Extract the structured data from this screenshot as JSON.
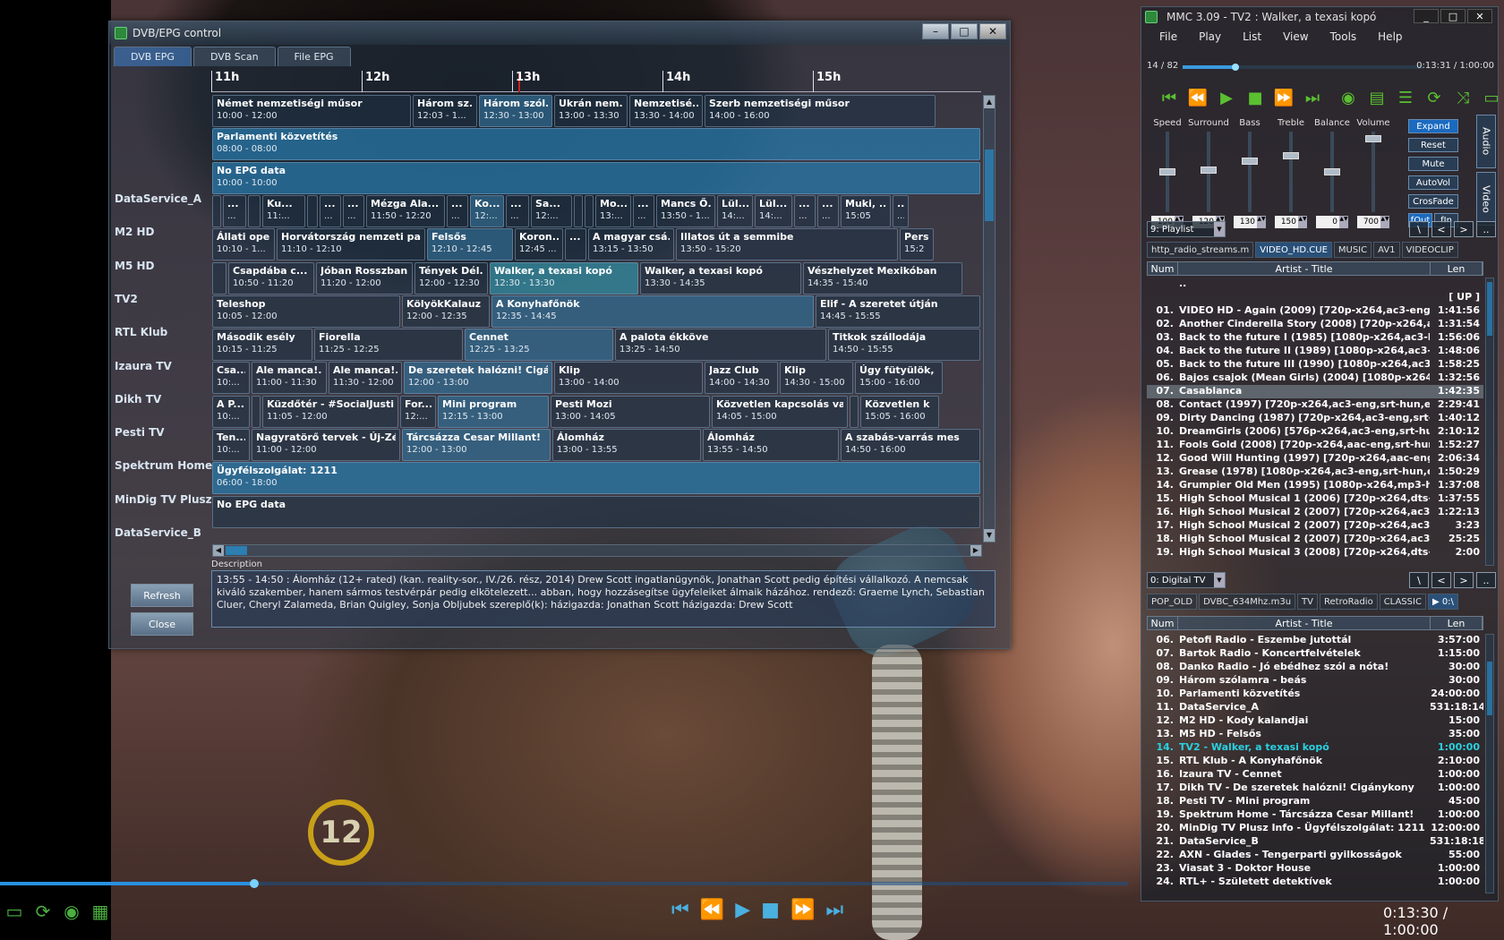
{
  "dvb": {
    "title": "DVB/EPG control",
    "tabs": [
      {
        "label": "DVB EPG",
        "active": true
      },
      {
        "label": "DVB Scan",
        "active": false
      },
      {
        "label": "File EPG",
        "active": false
      }
    ],
    "hours": [
      "11h",
      "12h",
      "13h",
      "14h",
      "15h"
    ],
    "channels": [
      "DataService_A",
      "M2 HD",
      "M5 HD",
      "TV2",
      "RTL Klub",
      "Izaura TV",
      "Dikh TV",
      "Pesti TV",
      "Spektrum Home",
      "MinDig TV Plusz",
      "DataService_B"
    ],
    "rows": [
      [
        {
          "t": "Német nemzetiségi műsor",
          "tm": "10:00 - 12:00"
        },
        {
          "t": "Három sz...",
          "tm": "12:03 - 1..."
        },
        {
          "t": "Három szól...",
          "tm": "12:30 - 13:00"
        },
        {
          "t": "Ukrán nem...",
          "tm": "13:00 - 13:30"
        },
        {
          "t": "Nemzetisé...",
          "tm": "13:30 - 14:00"
        },
        {
          "t": "Szerb nemzetiségi műsor",
          "tm": "14:00 - 16:00"
        }
      ],
      [
        {
          "t": "Parlamenti közvetítés",
          "tm": "08:00 - 08:00"
        }
      ],
      [
        {
          "t": "No EPG data",
          "tm": "10:00 - 10:00"
        }
      ],
      [
        {
          "t": "",
          "tm": ""
        },
        {
          "t": "...",
          "tm": "..."
        },
        {
          "t": "",
          "tm": ""
        },
        {
          "t": "Ku...",
          "tm": "11:..."
        },
        {
          "t": "",
          "tm": ""
        },
        {
          "t": "...",
          "tm": "..."
        },
        {
          "t": "...",
          "tm": "..."
        },
        {
          "t": "Mézga Ala...",
          "tm": "11:50 - 12:20"
        },
        {
          "t": "...",
          "tm": "..."
        },
        {
          "t": "Ko...",
          "tm": "12:..."
        },
        {
          "t": "...",
          "tm": "..."
        },
        {
          "t": "Sa...",
          "tm": "12:..."
        },
        {
          "t": "",
          "tm": ""
        },
        {
          "t": "",
          "tm": ""
        },
        {
          "t": "Mo...",
          "tm": "13:..."
        },
        {
          "t": "...",
          "tm": "..."
        },
        {
          "t": "Mancs Ő...",
          "tm": "13:50 - 1..."
        },
        {
          "t": "Lül...",
          "tm": "14:..."
        },
        {
          "t": "Lül...",
          "tm": "14:..."
        },
        {
          "t": "...",
          "tm": "..."
        },
        {
          "t": "...",
          "tm": "..."
        },
        {
          "t": "Muki, ...",
          "tm": "15:05"
        },
        {
          "t": "...",
          "tm": "..."
        }
      ],
      [
        {
          "t": "Állati ope...",
          "tm": "10:10 - 1..."
        },
        {
          "t": "Horvátország nemzeti par...",
          "tm": "11:10 - 12:10"
        },
        {
          "t": "Felsős",
          "tm": "12:10 - 12:45"
        },
        {
          "t": "Koron...",
          "tm": "12:45 ..."
        },
        {
          "t": "...",
          "tm": ""
        },
        {
          "t": "A magyar csá...",
          "tm": "13:15 - 13:50"
        },
        {
          "t": "Illatos út a semmibe",
          "tm": "13:50 - 15:20"
        },
        {
          "t": "Pers",
          "tm": "15:2"
        }
      ],
      [
        {
          "t": "",
          "tm": ""
        },
        {
          "t": "Csapdába c...",
          "tm": "10:50 - 11:20"
        },
        {
          "t": "Jóban Rosszban",
          "tm": "11:20 - 12:00"
        },
        {
          "t": "Tények Dél...",
          "tm": "12:00 - 12:30"
        },
        {
          "t": "Walker, a texasi kopó",
          "tm": "12:30 - 13:30"
        },
        {
          "t": "Walker, a texasi kopó",
          "tm": "13:30 - 14:35"
        },
        {
          "t": "Vészhelyzet Mexikóban",
          "tm": "14:35 - 15:40"
        }
      ],
      [
        {
          "t": "Teleshop",
          "tm": "10:05 - 12:00"
        },
        {
          "t": "KölyökKalauz",
          "tm": "12:00 - 12:35"
        },
        {
          "t": "A Konyhafőnök",
          "tm": "12:35 - 14:45"
        },
        {
          "t": "Elif - A szeretet útján",
          "tm": "14:45 - 15:55"
        }
      ],
      [
        {
          "t": "Második esély",
          "tm": "10:15 - 11:25"
        },
        {
          "t": "Fiorella",
          "tm": "11:25 - 12:25"
        },
        {
          "t": "Cennet",
          "tm": "12:25 - 13:25"
        },
        {
          "t": "A palota ékköve",
          "tm": "13:25 - 14:50"
        },
        {
          "t": "Titkok szállodája",
          "tm": "14:50 - 15:55"
        }
      ],
      [
        {
          "t": "Csa...",
          "tm": "10:..."
        },
        {
          "t": "Ale manca!...",
          "tm": "11:00 - 11:30"
        },
        {
          "t": "Ale manca!...",
          "tm": "11:30 - 12:00"
        },
        {
          "t": "De szeretek halózni! Cigán...",
          "tm": "12:00 - 13:00"
        },
        {
          "t": "Klip",
          "tm": "13:00 - 14:00"
        },
        {
          "t": "Jazz Club",
          "tm": "14:00 - 14:30"
        },
        {
          "t": "Klip",
          "tm": "14:30 - 15:00"
        },
        {
          "t": "Úgy fütyülök, m",
          "tm": "15:00 - 16:00"
        }
      ],
      [
        {
          "t": "A P...",
          "tm": "10:..."
        },
        {
          "t": "",
          "tm": ""
        },
        {
          "t": "Küzdőtér - #SocialJustic...",
          "tm": "11:05 - 12:00"
        },
        {
          "t": "For...",
          "tm": "12:..."
        },
        {
          "t": "Mini program",
          "tm": "12:15 - 13:00"
        },
        {
          "t": "Pesti Mozi",
          "tm": "13:00 - 14:05"
        },
        {
          "t": "Közvetlen kapcsolás vag...",
          "tm": "14:05 - 15:00"
        },
        {
          "t": "",
          "tm": ""
        },
        {
          "t": "Közvetlen k",
          "tm": "15:05 - 16:00"
        }
      ],
      [
        {
          "t": "Ten...",
          "tm": "10:..."
        },
        {
          "t": "Nagyratörő tervek - Új-Zél...",
          "tm": "11:00 - 12:00"
        },
        {
          "t": "Tárcsázza Cesar Millant!",
          "tm": "12:00 - 13:00"
        },
        {
          "t": "Álomház",
          "tm": "13:00 - 13:55"
        },
        {
          "t": "Álomház",
          "tm": "13:55 - 14:50"
        },
        {
          "t": "A szabás-varrás mes",
          "tm": "14:50 - 16:00"
        }
      ],
      [
        {
          "t": "Ügyfélszolgálat: 1211",
          "tm": "06:00 - 18:00"
        }
      ],
      [
        {
          "t": "No EPG data",
          "tm": ""
        }
      ]
    ],
    "description_label": "Description",
    "description": "13:55 - 14:50 : Álomház (12+ rated) (kan. reality-sor., IV./26. rész, 2014)  Drew Scott ingatlanügynök, Jonathan Scott pedig építési vállalkozó. A nemcsak kiváló szakember, hanem sármos testvérpár pedig elkötelezett... abban, hogy hozzásegítse ügyfeleiket álmaik házához. rendező:  Graeme Lynch, Sebastian Cluer, Cheryl Zalameda, Brian Quigley, Sonja Obljubek szereplő(k): házigazda: Jonathan Scott házigazda: Drew Scott",
    "refresh_label": "Refresh",
    "close_label": "Close"
  },
  "video": {
    "rating": "12"
  },
  "player": {
    "seek_fraction": 0.225,
    "time": "0:13:30 / 1:00:00"
  },
  "mmc": {
    "title": "MMC 3.09 - TV2 : Walker, a texasi kopó",
    "menu": [
      "File",
      "Play",
      "List",
      "View",
      "Tools",
      "Help"
    ],
    "position": "14 / 82",
    "position_fraction": 0.22,
    "time": "0:13:31 / 1:00:00",
    "sliders": [
      {
        "label": "Speed",
        "value": "100",
        "level": 0.5
      },
      {
        "label": "Surround",
        "value": "120",
        "level": 0.52
      },
      {
        "label": "Bass",
        "value": "130",
        "level": 0.65
      },
      {
        "label": "Treble",
        "value": "150",
        "level": 0.72
      },
      {
        "label": "Balance",
        "value": "0",
        "level": 0.5
      },
      {
        "label": "Volume",
        "value": "700",
        "level": 0.95
      }
    ],
    "buttons": {
      "expand": "Expand",
      "reset": "Reset",
      "mute": "Mute",
      "autovol": "AutoVol",
      "crossfade": "CrosFade",
      "fout": "fOut",
      "fin": "fIn"
    },
    "vtabs": {
      "audio": "Audio",
      "video": "Video"
    },
    "playlist1": {
      "selector": "9:  Playlist",
      "tabs": [
        "http_radio_streams.m",
        "VIDEO_HD.CUE",
        "MUSIC",
        "AV1",
        "VIDEOCLIP"
      ],
      "active_tab": 1,
      "header": {
        "num": "Num",
        "title": "Artist - Title",
        "len": "Len"
      },
      "rows": [
        {
          "n": "",
          "a": "..",
          "l": ""
        },
        {
          "n": "",
          "a": "",
          "l": "[ UP ]"
        },
        {
          "n": "01.",
          "a": "VIDEO HD - Again (2009) [720p-x264,ac3-eng]",
          "l": "1:41:56"
        },
        {
          "n": "02.",
          "a": "Another Cinderella Story (2008) [720p-x264,aa]",
          "l": "1:31:54"
        },
        {
          "n": "03.",
          "a": "Back to the future I (1985) [1080p-x264,ac3-h]",
          "l": "1:56:06"
        },
        {
          "n": "04.",
          "a": "Back to the future II (1989) [1080p-x264,ac3-]",
          "l": "1:48:06"
        },
        {
          "n": "05.",
          "a": "Back to the future III (1990) [1080p-x264,ac3-]",
          "l": "1:58:25"
        },
        {
          "n": "06.",
          "a": "Bajos csajok (Mean Girls) (2004) [1080p-x264,]",
          "l": "1:32:56"
        },
        {
          "n": "07.",
          "a": "Casablanca",
          "l": "1:42:35",
          "sel": true
        },
        {
          "n": "08.",
          "a": "Contact (1997) [720p-x264,ac3-eng,srt-hun,en]",
          "l": "2:29:41"
        },
        {
          "n": "09.",
          "a": "Dirty Dancing (1987) [720p-x264,ac3-eng,srt-]",
          "l": "1:40:12"
        },
        {
          "n": "10.",
          "a": "DreamGirls (2006) [576p-x264,ac3-eng,srt-hun]",
          "l": "2:10:12"
        },
        {
          "n": "11.",
          "a": "Fools Gold (2008) [720p-x264,aac-eng,srt-hun]",
          "l": "1:52:27"
        },
        {
          "n": "12.",
          "a": "Good Will Hunting (1997) [720p-x264,aac-eng]",
          "l": "2:06:34"
        },
        {
          "n": "13.",
          "a": "Grease (1978) [1080p-x264,ac3-eng,srt-hun,e]",
          "l": "1:50:29"
        },
        {
          "n": "14.",
          "a": "Grumpier Old Men (1995) [1080p-x264,mp3-hu]",
          "l": "1:37:08"
        },
        {
          "n": "15.",
          "a": "High School Musical 1 (2006) [720p-x264,dts-]",
          "l": "1:37:55"
        },
        {
          "n": "16.",
          "a": "High School Musical 2 (2007) [720p-x264,ac3]",
          "l": "1:22:13"
        },
        {
          "n": "17.",
          "a": "High School Musical 2 (2007) [720p-x264,ac3]",
          "l": "3:23"
        },
        {
          "n": "18.",
          "a": "High School Musical 2 (2007) [720p-x264,ac3]",
          "l": "25:25"
        },
        {
          "n": "19.",
          "a": "High School Musical 3 (2008) [720p-x264,dts-]",
          "l": "2:00"
        }
      ]
    },
    "playlist2": {
      "selector": "0:  Digital TV",
      "tabs": [
        "POP_OLD",
        "DVBC_634Mhz.m3u",
        "TV",
        "RetroRadio",
        "CLASSIC",
        "▶   0:\\"
      ],
      "active_tab": 5,
      "header": {
        "num": "Num",
        "title": "Artist - Title",
        "len": "Len"
      },
      "rows": [
        {
          "n": "06.",
          "a": "Petofi Radio - Eszembe jutottál",
          "l": "3:57:00"
        },
        {
          "n": "07.",
          "a": "Bartok Radio - Koncertfelvételek",
          "l": "1:15:00"
        },
        {
          "n": "08.",
          "a": "Danko Radio - Jó ebédhez szól a nóta!",
          "l": "30:00"
        },
        {
          "n": "09.",
          "a": "Három szólamra - beás",
          "l": "30:00"
        },
        {
          "n": "10.",
          "a": "Parlamenti közvetítés",
          "l": "24:00:00"
        },
        {
          "n": "11.",
          "a": "DataService_A",
          "l": "531:18:14"
        },
        {
          "n": "12.",
          "a": "M2 HD - Kody kalandjai",
          "l": "15:00"
        },
        {
          "n": "13.",
          "a": "M5 HD - Felsős",
          "l": "35:00"
        },
        {
          "n": "14.",
          "a": "TV2 - Walker, a texasi kopó",
          "l": "1:00:00",
          "now": true
        },
        {
          "n": "15.",
          "a": "RTL Klub - A Konyhafőnök",
          "l": "2:10:00"
        },
        {
          "n": "16.",
          "a": "Izaura TV - Cennet",
          "l": "1:00:00"
        },
        {
          "n": "17.",
          "a": "Dikh TV - De szeretek halózni! Cigánykony",
          "l": "1:00:00"
        },
        {
          "n": "18.",
          "a": "Pesti TV - Mini program",
          "l": "45:00"
        },
        {
          "n": "19.",
          "a": "Spektrum Home - Tárcsázza Cesar Millant!",
          "l": "1:00:00"
        },
        {
          "n": "20.",
          "a": "MinDig TV Plusz Info - Ügyfélszolgálat: 1211",
          "l": "12:00:00"
        },
        {
          "n": "21.",
          "a": "DataService_B",
          "l": "531:18:18"
        },
        {
          "n": "22.",
          "a": "AXN - Glades - Tengerparti gyilkosságok",
          "l": "55:00"
        },
        {
          "n": "23.",
          "a": "Viasat 3 - Doktor House",
          "l": "1:00:00"
        },
        {
          "n": "24.",
          "a": "RTL+ - Született detektívek",
          "l": "1:00:00"
        }
      ]
    },
    "colors": {
      "accent": "#2a90e0",
      "now_playing": "#2ad0e0",
      "transport": "#5ac030"
    }
  }
}
